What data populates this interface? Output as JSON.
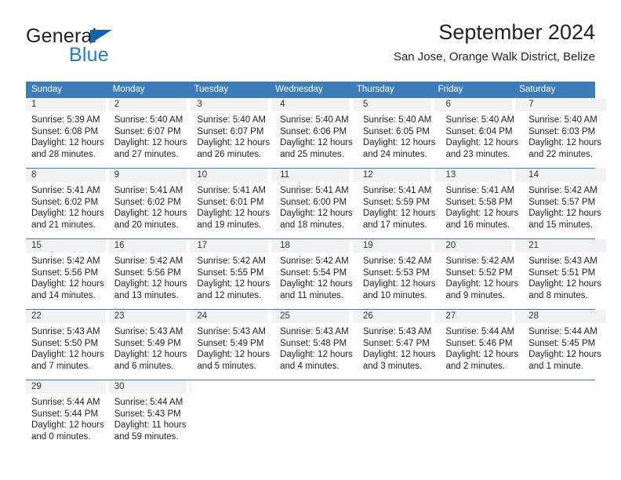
{
  "brand": {
    "name_part1": "General",
    "name_part2": "Blue",
    "accent_color": "#1f7fc4"
  },
  "header": {
    "title": "September 2024",
    "subtitle": "San Jose, Orange Walk District, Belize"
  },
  "theme": {
    "header_bar_color": "#3c7cb8",
    "daynum_band_color": "#f2f2f2",
    "text_color": "#222222"
  },
  "weekdays": [
    "Sunday",
    "Monday",
    "Tuesday",
    "Wednesday",
    "Thursday",
    "Friday",
    "Saturday"
  ],
  "weeks": [
    [
      {
        "day": "1",
        "sunrise": "Sunrise: 5:39 AM",
        "sunset": "Sunset: 6:08 PM",
        "daylight_1": "Daylight: 12 hours",
        "daylight_2": "and 28 minutes."
      },
      {
        "day": "2",
        "sunrise": "Sunrise: 5:40 AM",
        "sunset": "Sunset: 6:07 PM",
        "daylight_1": "Daylight: 12 hours",
        "daylight_2": "and 27 minutes."
      },
      {
        "day": "3",
        "sunrise": "Sunrise: 5:40 AM",
        "sunset": "Sunset: 6:07 PM",
        "daylight_1": "Daylight: 12 hours",
        "daylight_2": "and 26 minutes."
      },
      {
        "day": "4",
        "sunrise": "Sunrise: 5:40 AM",
        "sunset": "Sunset: 6:06 PM",
        "daylight_1": "Daylight: 12 hours",
        "daylight_2": "and 25 minutes."
      },
      {
        "day": "5",
        "sunrise": "Sunrise: 5:40 AM",
        "sunset": "Sunset: 6:05 PM",
        "daylight_1": "Daylight: 12 hours",
        "daylight_2": "and 24 minutes."
      },
      {
        "day": "6",
        "sunrise": "Sunrise: 5:40 AM",
        "sunset": "Sunset: 6:04 PM",
        "daylight_1": "Daylight: 12 hours",
        "daylight_2": "and 23 minutes."
      },
      {
        "day": "7",
        "sunrise": "Sunrise: 5:40 AM",
        "sunset": "Sunset: 6:03 PM",
        "daylight_1": "Daylight: 12 hours",
        "daylight_2": "and 22 minutes."
      }
    ],
    [
      {
        "day": "8",
        "sunrise": "Sunrise: 5:41 AM",
        "sunset": "Sunset: 6:02 PM",
        "daylight_1": "Daylight: 12 hours",
        "daylight_2": "and 21 minutes."
      },
      {
        "day": "9",
        "sunrise": "Sunrise: 5:41 AM",
        "sunset": "Sunset: 6:02 PM",
        "daylight_1": "Daylight: 12 hours",
        "daylight_2": "and 20 minutes."
      },
      {
        "day": "10",
        "sunrise": "Sunrise: 5:41 AM",
        "sunset": "Sunset: 6:01 PM",
        "daylight_1": "Daylight: 12 hours",
        "daylight_2": "and 19 minutes."
      },
      {
        "day": "11",
        "sunrise": "Sunrise: 5:41 AM",
        "sunset": "Sunset: 6:00 PM",
        "daylight_1": "Daylight: 12 hours",
        "daylight_2": "and 18 minutes."
      },
      {
        "day": "12",
        "sunrise": "Sunrise: 5:41 AM",
        "sunset": "Sunset: 5:59 PM",
        "daylight_1": "Daylight: 12 hours",
        "daylight_2": "and 17 minutes."
      },
      {
        "day": "13",
        "sunrise": "Sunrise: 5:41 AM",
        "sunset": "Sunset: 5:58 PM",
        "daylight_1": "Daylight: 12 hours",
        "daylight_2": "and 16 minutes."
      },
      {
        "day": "14",
        "sunrise": "Sunrise: 5:42 AM",
        "sunset": "Sunset: 5:57 PM",
        "daylight_1": "Daylight: 12 hours",
        "daylight_2": "and 15 minutes."
      }
    ],
    [
      {
        "day": "15",
        "sunrise": "Sunrise: 5:42 AM",
        "sunset": "Sunset: 5:56 PM",
        "daylight_1": "Daylight: 12 hours",
        "daylight_2": "and 14 minutes."
      },
      {
        "day": "16",
        "sunrise": "Sunrise: 5:42 AM",
        "sunset": "Sunset: 5:56 PM",
        "daylight_1": "Daylight: 12 hours",
        "daylight_2": "and 13 minutes."
      },
      {
        "day": "17",
        "sunrise": "Sunrise: 5:42 AM",
        "sunset": "Sunset: 5:55 PM",
        "daylight_1": "Daylight: 12 hours",
        "daylight_2": "and 12 minutes."
      },
      {
        "day": "18",
        "sunrise": "Sunrise: 5:42 AM",
        "sunset": "Sunset: 5:54 PM",
        "daylight_1": "Daylight: 12 hours",
        "daylight_2": "and 11 minutes."
      },
      {
        "day": "19",
        "sunrise": "Sunrise: 5:42 AM",
        "sunset": "Sunset: 5:53 PM",
        "daylight_1": "Daylight: 12 hours",
        "daylight_2": "and 10 minutes."
      },
      {
        "day": "20",
        "sunrise": "Sunrise: 5:42 AM",
        "sunset": "Sunset: 5:52 PM",
        "daylight_1": "Daylight: 12 hours",
        "daylight_2": "and 9 minutes."
      },
      {
        "day": "21",
        "sunrise": "Sunrise: 5:43 AM",
        "sunset": "Sunset: 5:51 PM",
        "daylight_1": "Daylight: 12 hours",
        "daylight_2": "and 8 minutes."
      }
    ],
    [
      {
        "day": "22",
        "sunrise": "Sunrise: 5:43 AM",
        "sunset": "Sunset: 5:50 PM",
        "daylight_1": "Daylight: 12 hours",
        "daylight_2": "and 7 minutes."
      },
      {
        "day": "23",
        "sunrise": "Sunrise: 5:43 AM",
        "sunset": "Sunset: 5:49 PM",
        "daylight_1": "Daylight: 12 hours",
        "daylight_2": "and 6 minutes."
      },
      {
        "day": "24",
        "sunrise": "Sunrise: 5:43 AM",
        "sunset": "Sunset: 5:49 PM",
        "daylight_1": "Daylight: 12 hours",
        "daylight_2": "and 5 minutes."
      },
      {
        "day": "25",
        "sunrise": "Sunrise: 5:43 AM",
        "sunset": "Sunset: 5:48 PM",
        "daylight_1": "Daylight: 12 hours",
        "daylight_2": "and 4 minutes."
      },
      {
        "day": "26",
        "sunrise": "Sunrise: 5:43 AM",
        "sunset": "Sunset: 5:47 PM",
        "daylight_1": "Daylight: 12 hours",
        "daylight_2": "and 3 minutes."
      },
      {
        "day": "27",
        "sunrise": "Sunrise: 5:44 AM",
        "sunset": "Sunset: 5:46 PM",
        "daylight_1": "Daylight: 12 hours",
        "daylight_2": "and 2 minutes."
      },
      {
        "day": "28",
        "sunrise": "Sunrise: 5:44 AM",
        "sunset": "Sunset: 5:45 PM",
        "daylight_1": "Daylight: 12 hours",
        "daylight_2": "and 1 minute."
      }
    ],
    [
      {
        "day": "29",
        "sunrise": "Sunrise: 5:44 AM",
        "sunset": "Sunset: 5:44 PM",
        "daylight_1": "Daylight: 12 hours",
        "daylight_2": "and 0 minutes."
      },
      {
        "day": "30",
        "sunrise": "Sunrise: 5:44 AM",
        "sunset": "Sunset: 5:43 PM",
        "daylight_1": "Daylight: 11 hours",
        "daylight_2": "and 59 minutes."
      },
      {
        "day": "",
        "sunrise": "",
        "sunset": "",
        "daylight_1": "",
        "daylight_2": ""
      },
      {
        "day": "",
        "sunrise": "",
        "sunset": "",
        "daylight_1": "",
        "daylight_2": ""
      },
      {
        "day": "",
        "sunrise": "",
        "sunset": "",
        "daylight_1": "",
        "daylight_2": ""
      },
      {
        "day": "",
        "sunrise": "",
        "sunset": "",
        "daylight_1": "",
        "daylight_2": ""
      },
      {
        "day": "",
        "sunrise": "",
        "sunset": "",
        "daylight_1": "",
        "daylight_2": ""
      }
    ]
  ]
}
